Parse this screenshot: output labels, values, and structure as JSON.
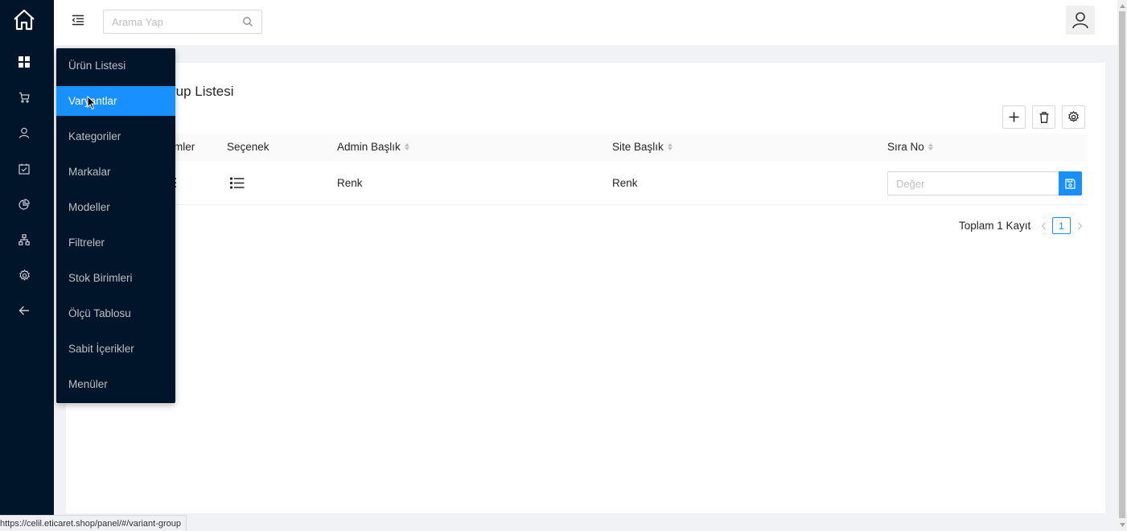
{
  "sidebar": {
    "home_icon": "home-icon",
    "nav_icons": [
      "dashboard-icon",
      "cart-icon",
      "user-icon",
      "calendar-check-icon",
      "pie-chart-icon",
      "sitemap-icon",
      "settings-icon",
      "back-arrow-icon"
    ]
  },
  "header": {
    "search_placeholder": "Arama Yap"
  },
  "submenu": {
    "items": [
      {
        "label": "Ürün Listesi"
      },
      {
        "label": "Varyantlar"
      },
      {
        "label": "Kategoriler"
      },
      {
        "label": "Markalar"
      },
      {
        "label": "Modeller"
      },
      {
        "label": "Filtreler"
      },
      {
        "label": "Stok Birimleri"
      },
      {
        "label": "Ölçü Tablosu"
      },
      {
        "label": "Sabit İçerikler"
      },
      {
        "label": "Menüler"
      }
    ],
    "active_index": 1
  },
  "page": {
    "title_fragment": "rup Listesi"
  },
  "table": {
    "columns": [
      {
        "label": "mler",
        "sortable": false
      },
      {
        "label": "Seçenek",
        "sortable": false
      },
      {
        "label": "Admin Başlık",
        "sortable": true
      },
      {
        "label": "Site Başlık",
        "sortable": true
      },
      {
        "label": "Sıra No",
        "sortable": true
      }
    ],
    "rows": [
      {
        "admin_title": "Renk",
        "site_title": "Renk",
        "order_placeholder": "Değer"
      }
    ]
  },
  "pagination": {
    "total_text": "Toplam 1 Kayıt",
    "current_page": "1"
  },
  "statusbar": {
    "url": "https://celil.eticaret.shop/panel/#/variant-group"
  },
  "colors": {
    "sidebar_bg": "#001529",
    "accent": "#1890ff",
    "page_bg": "#f0f2f5"
  }
}
